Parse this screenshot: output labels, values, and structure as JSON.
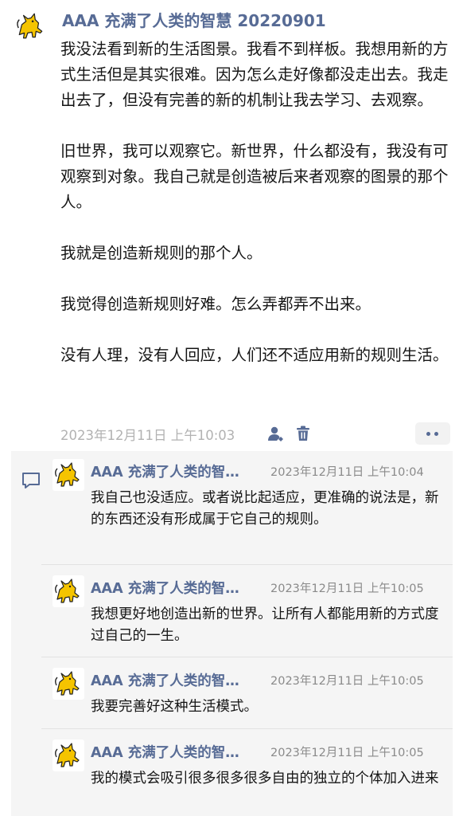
{
  "post": {
    "author": "AAA 充满了人类的智慧 20220901",
    "paragraphs": [
      "我没法看到新的生活图景。我看不到样板。我想用新的方式生活但是其实很难。因为怎么走好像都没走出去。我走出去了，但没有完善的新的机制让我去学习、去观察。",
      "旧世界，我可以观察它。新世界，什么都没有，我没有可观察到对象。我自己就是创造被后来者观察的图景的那个人。",
      "我就是创造新规则的那个人。",
      "我觉得创造新规则好难。怎么弄都弄不出来。",
      "没有人理，没有人回应，人们还不适应用新的规则生活。"
    ],
    "time": "2023年12月11日 上午10:03"
  },
  "comments": [
    {
      "author": "AAA 充满了人类的智…",
      "time": "2023年12月11日 上午10:04",
      "text": "我自己也没适应。或者说比起适应，更准确的说法是，新的东西还没有形成属于它自己的规则。"
    },
    {
      "author": "AAA 充满了人类的智…",
      "time": "2023年12月11日 上午10:05",
      "text": "我想更好地创造出新的世界。让所有人都能用新的方式度过自己的一生。"
    },
    {
      "author": "AAA 充满了人类的智…",
      "time": "2023年12月11日 上午10:05",
      "text": "我要完善好这种生活模式。"
    },
    {
      "author": "AAA 充满了人类的智…",
      "time": "2023年12月11日 上午10:05",
      "text": "我的模式会吸引很多很多很多自由的独立的个体加入进来"
    }
  ],
  "icons": {
    "avatar": "yellow-cat-avatar",
    "visibility": "person-icon",
    "delete": "trash-icon",
    "more": "more-dots-icon",
    "comment": "comment-bubble-icon"
  },
  "colors": {
    "name": "#576b95",
    "meta": "#b2b2b2",
    "comment_bg": "#f5f5f5",
    "avatar_yellow": "#f5c400"
  }
}
